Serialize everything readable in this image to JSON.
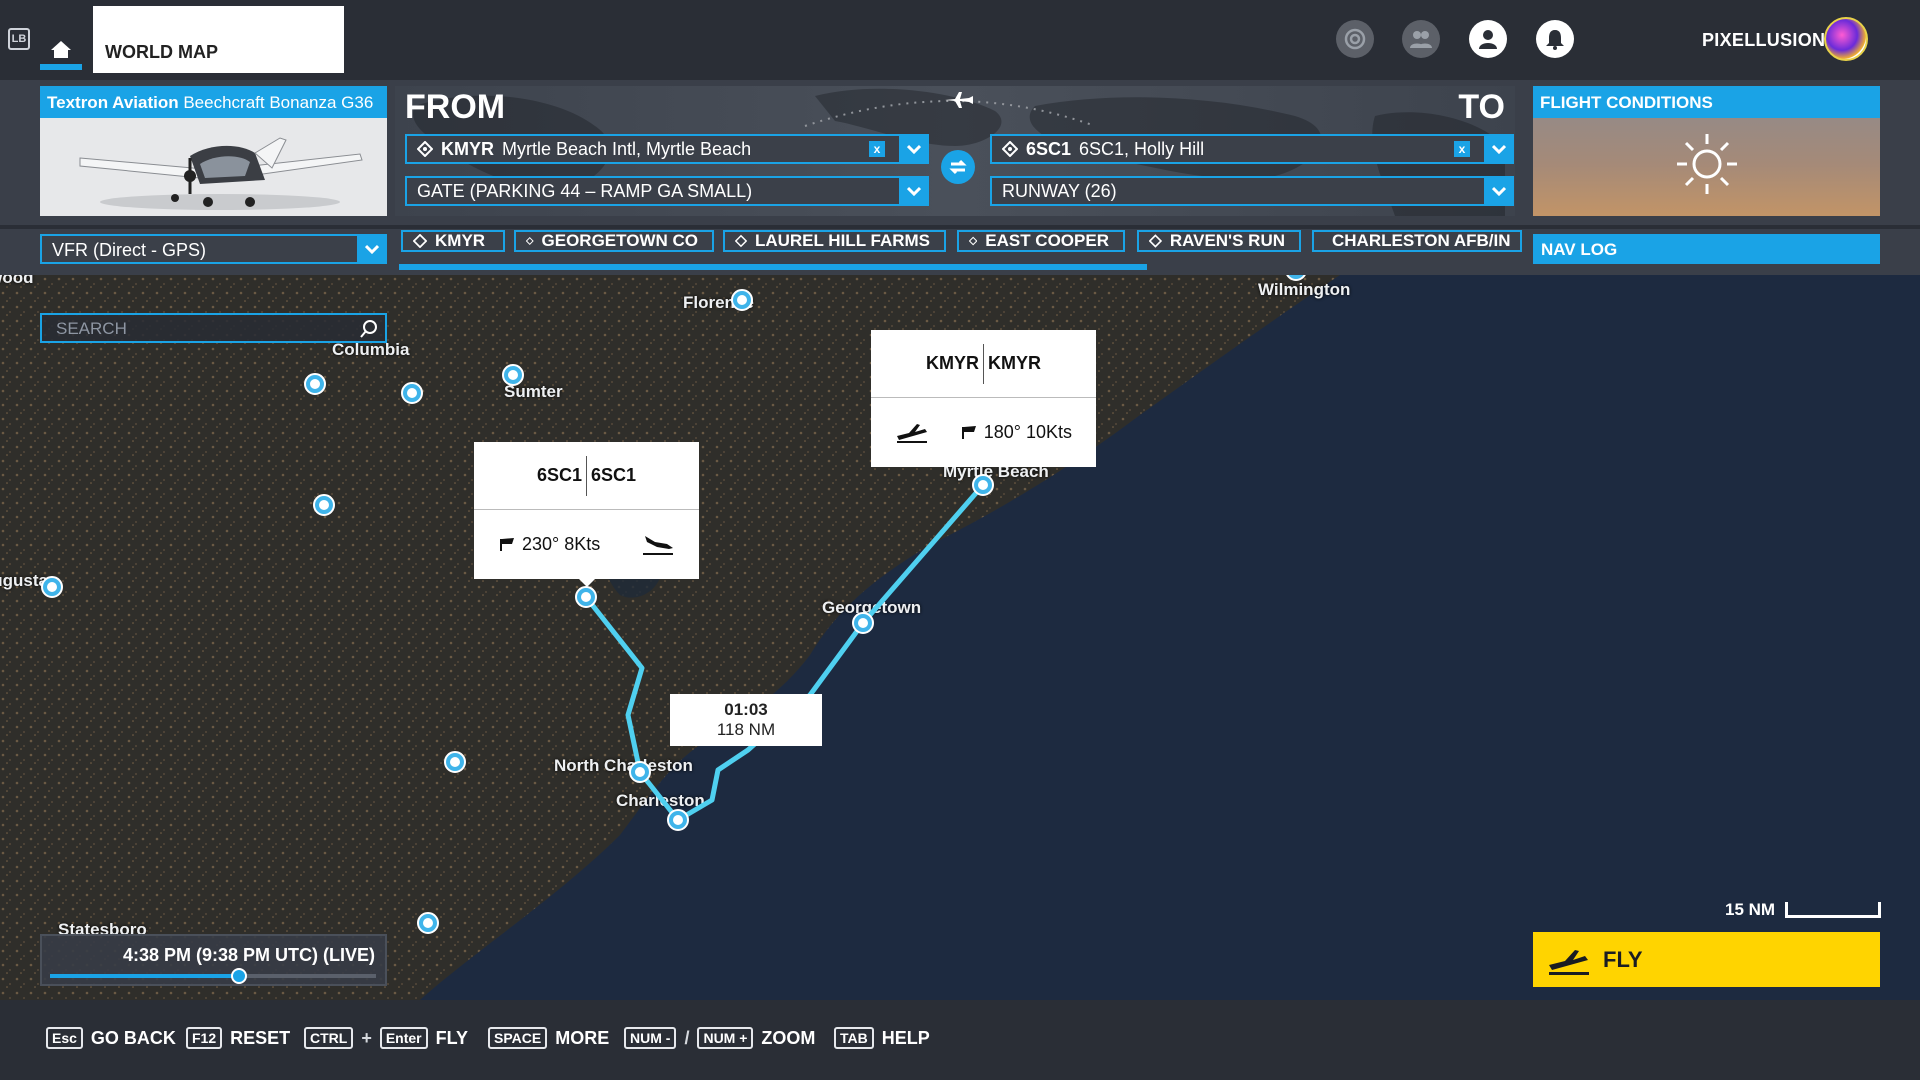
{
  "topbar": {
    "lb_label": "LB",
    "world_map_tab": "WORLD MAP",
    "username": "PIXELLUSION",
    "icons": [
      "achievements-icon",
      "friends-icon",
      "profile-icon",
      "notifications-icon"
    ]
  },
  "aircraft": {
    "maker": "Textron Aviation",
    "model": "Beechcraft Bonanza G36"
  },
  "flight": {
    "from_label": "FROM",
    "to_label": "TO",
    "departure": {
      "icao": "KMYR",
      "name": "Myrtle Beach Intl, Myrtle Beach",
      "clear": "x",
      "position": "GATE (PARKING 44 – RAMP GA SMALL)"
    },
    "arrival": {
      "icao": "6SC1",
      "name": "6SC1, Holly Hill",
      "clear": "x",
      "position": "RUNWAY (26)"
    }
  },
  "conditions": {
    "title": "FLIGHT CONDITIONS",
    "weather_icon": "sun-icon"
  },
  "flight_type": "VFR (Direct - GPS)",
  "waypoints": [
    "KMYR",
    "GEORGETOWN CO",
    "LAUREL HILL FARMS",
    "EAST COOPER",
    "RAVEN'S RUN",
    "CHARLESTON AFB/IN"
  ],
  "nav_log": "NAV LOG",
  "map": {
    "search_placeholder": "SEARCH",
    "cities": {
      "wilmington": "Wilmington",
      "florence": "Florence",
      "columbia": "Columbia",
      "sumter": "Sumter",
      "myrtle_beach": "Myrtle Beach",
      "georgetown": "Georgetown",
      "north_charleston": "North Charleston",
      "charleston": "Charleston",
      "augusta": "Augusta",
      "statesboro": "Statesboro",
      "greenwood": "Greenwood"
    },
    "departure_popup": {
      "icao": "KMYR",
      "code": "KMYR",
      "wind": "180° 10Kts"
    },
    "arrival_popup": {
      "icao": "6SC1",
      "code": "6SC1",
      "wind": "230° 8Kts"
    },
    "route": {
      "time": "01:03",
      "distance": "118 NM"
    },
    "time": {
      "label": "4:38 PM (9:38 PM UTC) (LIVE)",
      "progress": 0.58
    },
    "scale": "15 NM"
  },
  "fly_button": "FLY",
  "hints": [
    {
      "keys": [
        "Esc"
      ],
      "label": "GO BACK"
    },
    {
      "keys": [
        "F12"
      ],
      "label": "RESET"
    },
    {
      "keys": [
        "CTRL",
        "Enter"
      ],
      "label": "FLY"
    },
    {
      "keys": [
        "SPACE"
      ],
      "label": "MORE"
    },
    {
      "keys": [
        "NUM -",
        "NUM +"
      ],
      "label": "ZOOM"
    },
    {
      "keys": [
        "TAB"
      ],
      "label": "HELP"
    }
  ],
  "colors": {
    "accent": "#1aa3e6",
    "fly": "#ffd400",
    "route": "#4fd0f0"
  }
}
